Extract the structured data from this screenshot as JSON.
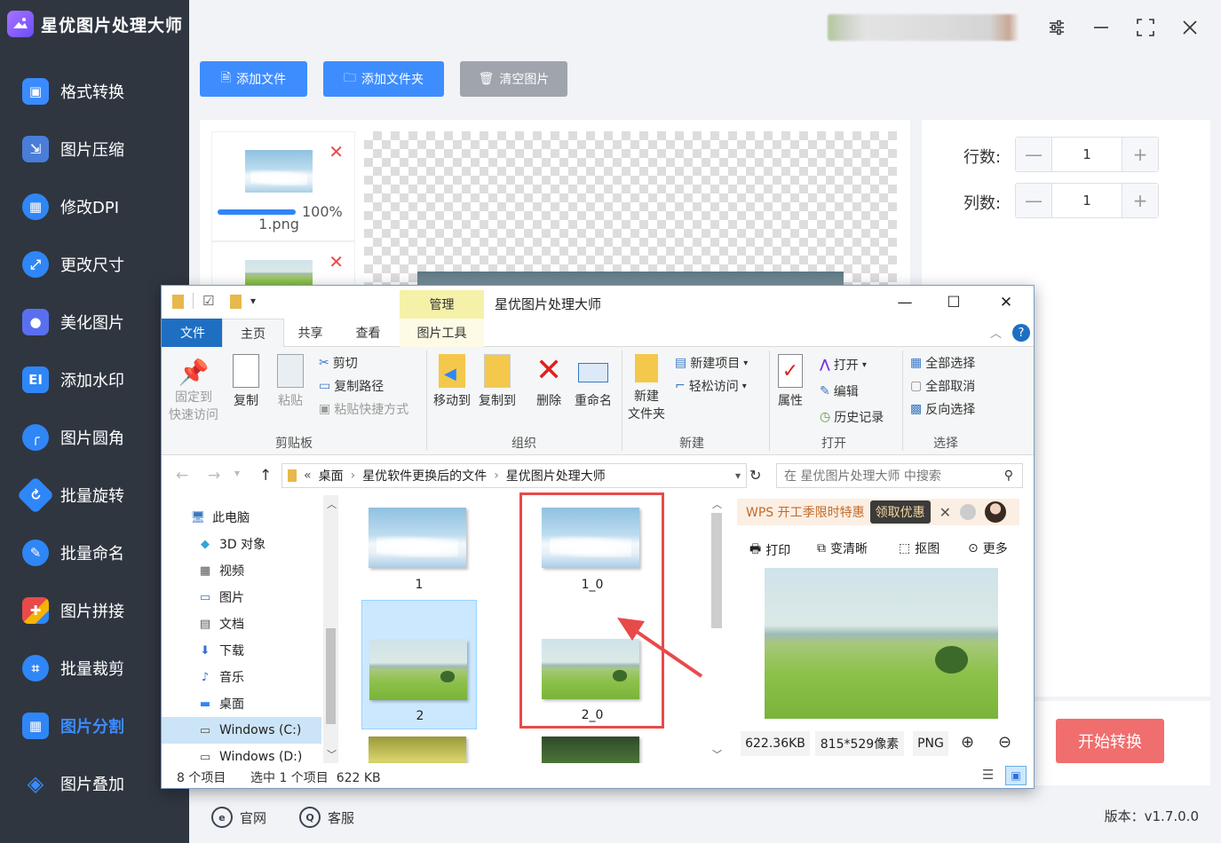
{
  "app": {
    "title": "星优图片处理大师",
    "version": "版本：v1.7.0.0"
  },
  "sidebar": {
    "items": [
      {
        "label": "格式转换",
        "icon": "image-convert-icon",
        "color": "#3b8bff"
      },
      {
        "label": "图片压缩",
        "icon": "image-compress-icon",
        "color": "#4a7dd9"
      },
      {
        "label": "修改DPI",
        "icon": "dpi-icon",
        "color": "#2f86f6"
      },
      {
        "label": "更改尺寸",
        "icon": "resize-icon",
        "color": "#2f86f6"
      },
      {
        "label": "美化图片",
        "icon": "beautify-icon",
        "color": "#5a6ff0"
      },
      {
        "label": "添加水印",
        "icon": "watermark-icon",
        "color": "#2f86f6"
      },
      {
        "label": "图片圆角",
        "icon": "round-corner-icon",
        "color": "#2f86f6"
      },
      {
        "label": "批量旋转",
        "icon": "rotate-icon",
        "color": "#2f86f6"
      },
      {
        "label": "批量命名",
        "icon": "rename-icon",
        "color": "#2f86f6"
      },
      {
        "label": "图片拼接",
        "icon": "puzzle-icon",
        "color": "#e84a4a"
      },
      {
        "label": "批量裁剪",
        "icon": "crop-icon",
        "color": "#2f86f6"
      },
      {
        "label": "图片分割",
        "icon": "split-icon",
        "color": "#2f86f6",
        "active": true
      },
      {
        "label": "图片叠加",
        "icon": "layers-icon",
        "color": "#2f86f6"
      }
    ]
  },
  "toolbar": {
    "add_file": "添加文件",
    "add_folder": "添加文件夹",
    "clear": "清空图片"
  },
  "file_list": [
    {
      "name": "1.png",
      "progress_text": "100%",
      "progress": 1.0
    }
  ],
  "settings": {
    "rows_label": "行数:",
    "rows_value": "1",
    "cols_label": "列数:",
    "cols_value": "1",
    "minus": "—",
    "plus": "+",
    "start_button": "开始转换"
  },
  "footer": {
    "website": "官网",
    "support": "客服"
  },
  "explorer": {
    "title": "星优图片处理大师",
    "manage_tab": "管理",
    "tabs": [
      "文件",
      "主页",
      "共享",
      "查看",
      "图片工具"
    ],
    "ribbon": {
      "clipboard": {
        "pin": "固定到\n快速访问",
        "copy": "复制",
        "paste": "粘贴",
        "cut": "剪切",
        "copy_path": "复制路径",
        "paste_shortcut": "粘贴快捷方式",
        "label": "剪贴板"
      },
      "organize": {
        "move_to": "移动到",
        "copy_to": "复制到",
        "delete": "删除",
        "rename": "重命名",
        "label": "组织"
      },
      "new": {
        "new_folder_1": "新建",
        "new_folder_2": "文件夹",
        "new_item": "新建项目",
        "easy_access": "轻松访问",
        "label": "新建"
      },
      "open": {
        "properties": "属性",
        "open": "打开",
        "edit": "编辑",
        "history": "历史记录",
        "label": "打开"
      },
      "select": {
        "select_all": "全部选择",
        "select_none": "全部取消",
        "invert": "反向选择",
        "label": "选择"
      }
    },
    "address": {
      "prefix": "«",
      "crumbs": [
        "桌面",
        "星优软件更换后的文件",
        "星优图片处理大师"
      ],
      "search_placeholder": "在 星优图片处理大师 中搜索"
    },
    "tree": [
      {
        "label": "此电脑",
        "icon": "computer-icon"
      },
      {
        "label": "3D 对象",
        "icon": "cube-icon"
      },
      {
        "label": "视频",
        "icon": "video-icon"
      },
      {
        "label": "图片",
        "icon": "pictures-icon"
      },
      {
        "label": "文档",
        "icon": "document-icon"
      },
      {
        "label": "下载",
        "icon": "download-icon"
      },
      {
        "label": "音乐",
        "icon": "music-icon"
      },
      {
        "label": "桌面",
        "icon": "desktop-icon"
      },
      {
        "label": "Windows (C:)",
        "icon": "drive-icon",
        "selected": true
      },
      {
        "label": "Windows (D:)",
        "icon": "drive-icon"
      }
    ],
    "files": [
      {
        "name": "1",
        "kind": "sky"
      },
      {
        "name": "1_0",
        "kind": "sky"
      },
      {
        "name": "2",
        "kind": "meadow",
        "selected": true
      },
      {
        "name": "2_0",
        "kind": "meadow"
      },
      {
        "name": "",
        "kind": "yellow"
      },
      {
        "name": "",
        "kind": "forest"
      }
    ],
    "preview": {
      "wps_text": "WPS 开工季限时特惠",
      "wps_cta": "领取优惠",
      "tools": [
        "打印",
        "变清晰",
        "抠图",
        "更多"
      ],
      "size": "622.36KB",
      "dims": "815*529像素",
      "format": "PNG"
    },
    "status": {
      "count": "8 个项目",
      "selected": "选中 1 个项目  622 KB"
    }
  }
}
